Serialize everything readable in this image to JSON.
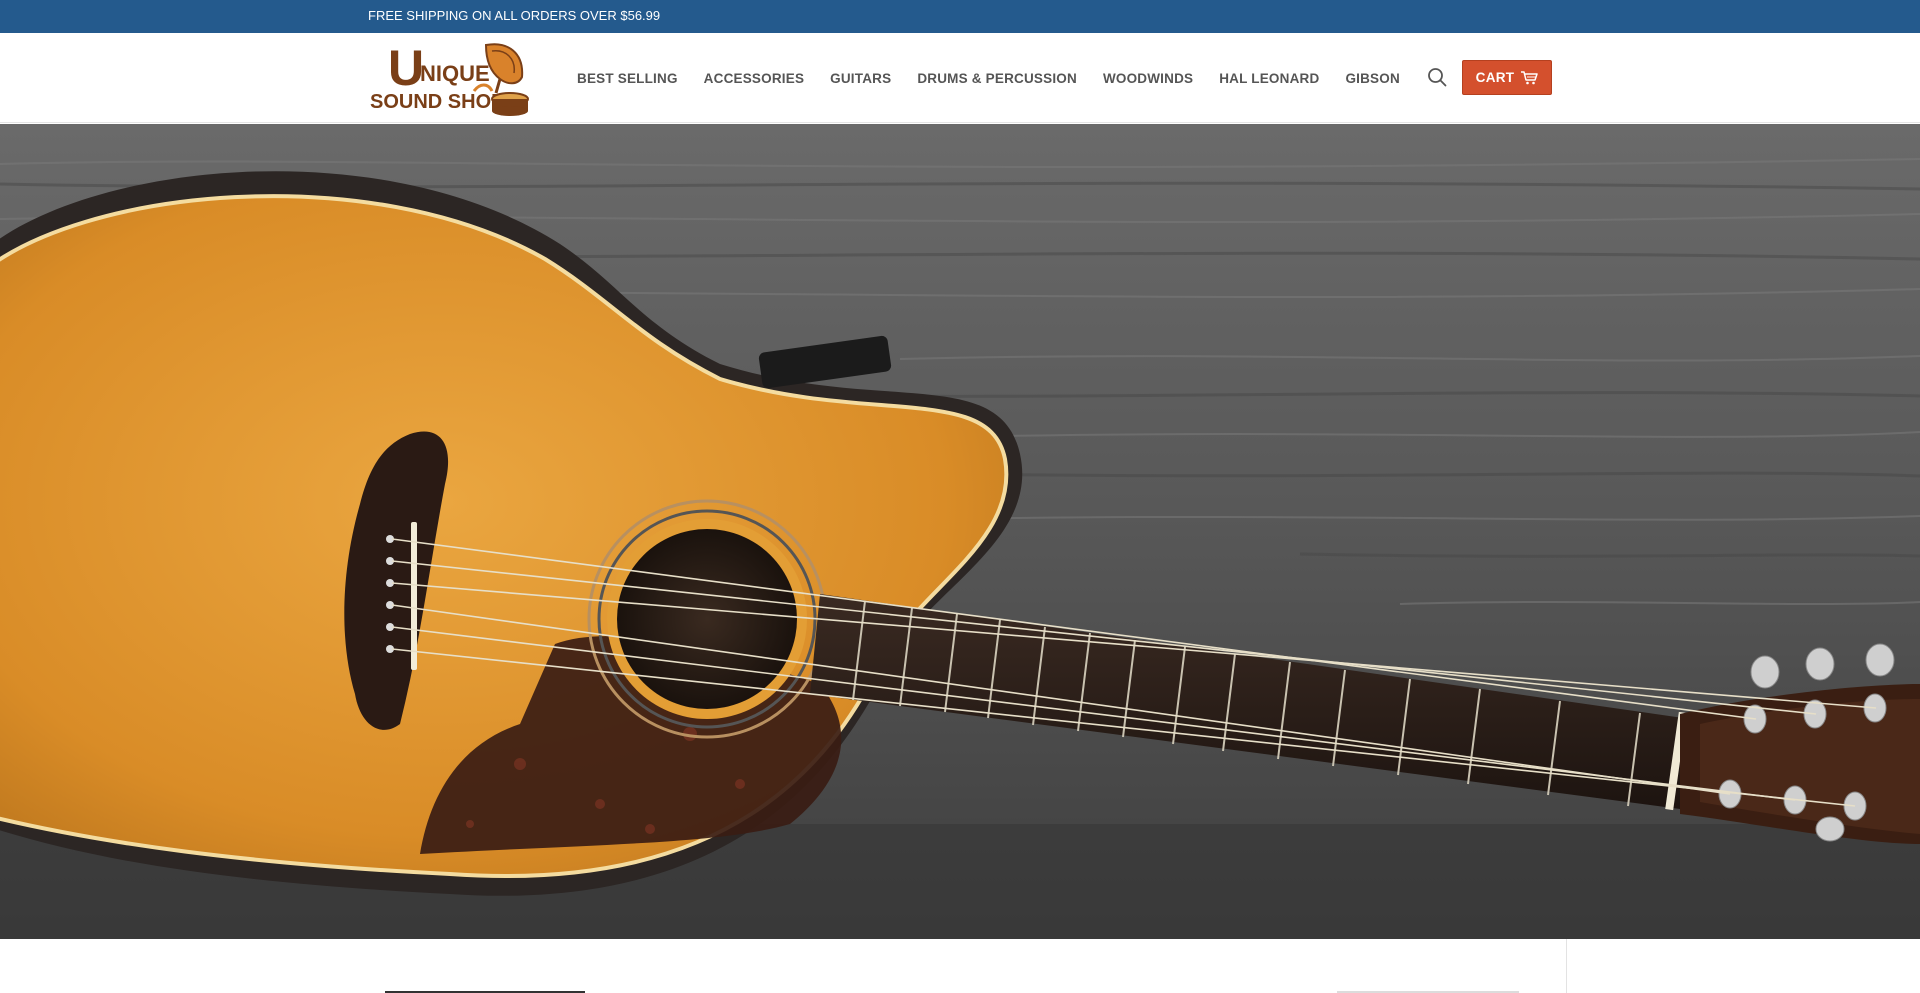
{
  "announcement": {
    "text": "FREE SHIPPING ON ALL ORDERS OVER $56.99"
  },
  "brand": {
    "name_line1": "NIQUE",
    "name_line2": "SOUND SHOP",
    "initial": "U"
  },
  "nav": {
    "items": [
      {
        "label": "BEST SELLING"
      },
      {
        "label": "ACCESSORIES"
      },
      {
        "label": "GUITARS"
      },
      {
        "label": "DRUMS & PERCUSSION"
      },
      {
        "label": "WOODWINDS"
      },
      {
        "label": "HAL LEONARD"
      },
      {
        "label": "GIBSON"
      }
    ]
  },
  "header": {
    "search_icon": "search-icon",
    "cart_label": "CART",
    "cart_icon": "cart-icon"
  },
  "hero": {
    "image": "acoustic-guitar-on-wood-background"
  },
  "colors": {
    "announcement_bg": "#245a8d",
    "cart_bg": "#d4502d",
    "brand_brown": "#7a3f17",
    "nav_text": "#555555"
  }
}
